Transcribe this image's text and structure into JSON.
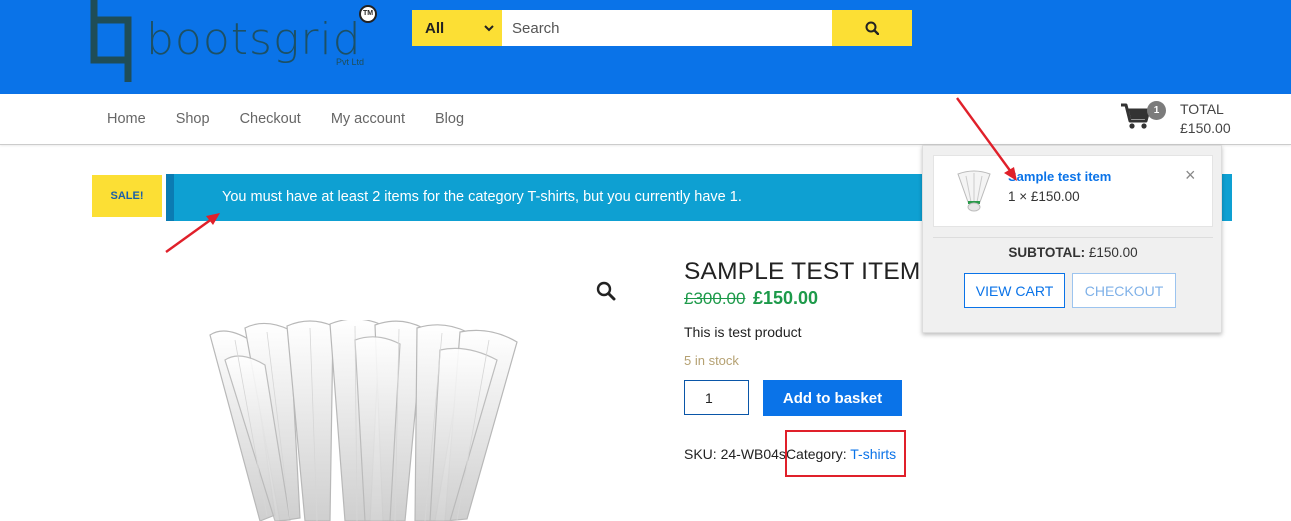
{
  "header": {
    "logo_text": "bootsgrid",
    "logo_sub": "Pvt Ltd",
    "logo_tm": "TM",
    "search": {
      "category": "All",
      "placeholder": "Search"
    }
  },
  "nav": {
    "items": [
      "Home",
      "Shop",
      "Checkout",
      "My account",
      "Blog"
    ]
  },
  "cart": {
    "count": "1",
    "label": "TOTAL",
    "total": "£150.00"
  },
  "notice": {
    "badge": "SALE!",
    "message": "You must have at least 2 items for the category T-shirts, but you currently have 1."
  },
  "product": {
    "title": "SAMPLE TEST ITEM",
    "price_old": "£300.00",
    "price_new": "£150.00",
    "description": "This is test product",
    "stock": "5 in stock",
    "quantity": "1",
    "add_label": "Add to basket",
    "sku_label": "SKU:",
    "sku": "24-WB04s",
    "category_label": "Category:",
    "category": "T-shirts"
  },
  "minicart": {
    "item_name": "Sample test item",
    "item_qty": "1 × £150.00",
    "remove": "×",
    "subtotal_label": "SUBTOTAL:",
    "subtotal_value": "£150.00",
    "view_cart": "VIEW CART",
    "checkout": "CHECKOUT"
  },
  "colors": {
    "brand_blue": "#0a73e8",
    "accent_yellow": "#fcdf34",
    "notice_blue": "#0ea0d2",
    "price_green": "#1d9a4a",
    "annotation_red": "#e0202a"
  }
}
